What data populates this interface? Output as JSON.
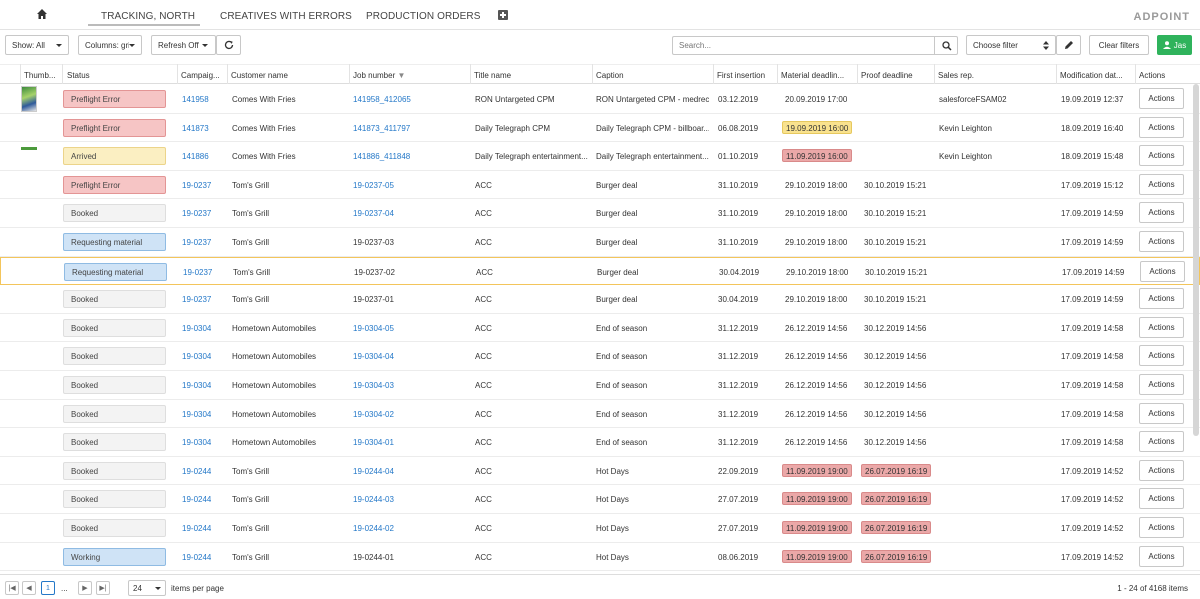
{
  "nav": {
    "tabs": [
      "TRACKING, NORTH",
      "CREATIVES WITH ERRORS",
      "PRODUCTION ORDERS"
    ],
    "brand": "ADPOINT"
  },
  "toolbar": {
    "show": "Show: All",
    "columns": "Columns: grid",
    "refresh": "Refresh Off",
    "search_placeholder": "Search...",
    "choose_filter": "Choose filter",
    "clear_filters": "Clear filters",
    "user": "Jas"
  },
  "columns": [
    "Thumb...",
    "Status",
    "Campaig...",
    "Customer name",
    "Job number",
    "Title name",
    "Caption",
    "First insertion",
    "Material deadlin...",
    "Proof deadline",
    "Sales rep.",
    "Modification dat...",
    "Actions"
  ],
  "action_label": "Actions",
  "rows": [
    {
      "status": "Preflight Error",
      "status_type": "error",
      "campaign": "141958",
      "customer": "Comes With Fries",
      "job": "141958_412065",
      "job_link": true,
      "title": "RON Untargeted CPM",
      "caption": "RON Untargeted CPM - medrec",
      "first": "03.12.2019",
      "material": "20.09.2019 17:00",
      "material_hl": "",
      "proof": "",
      "proof_hl": "",
      "sales": "salesforceFSAM02",
      "modified": "19.09.2019 12:37",
      "thumb": "tall"
    },
    {
      "status": "Preflight Error",
      "status_type": "error",
      "campaign": "141873",
      "customer": "Comes With Fries",
      "job": "141873_411797",
      "job_link": true,
      "title": "Daily Telegraph CPM",
      "caption": "Daily Telegraph CPM - billboar...",
      "first": "06.08.2019",
      "material": "19.09.2019 16:00",
      "material_hl": "yellow",
      "proof": "",
      "proof_hl": "",
      "sales": "Kevin Leighton",
      "modified": "18.09.2019 16:40",
      "thumb": ""
    },
    {
      "status": "Arrived",
      "status_type": "arrived",
      "campaign": "141886",
      "customer": "Comes With Fries",
      "job": "141886_411848",
      "job_link": true,
      "title": "Daily Telegraph entertainment...",
      "caption": "Daily Telegraph entertainment...",
      "first": "01.10.2019",
      "material": "11.09.2019 16:00",
      "material_hl": "red",
      "proof": "",
      "proof_hl": "",
      "sales": "Kevin Leighton",
      "modified": "18.09.2019 15:48",
      "thumb": "wide"
    },
    {
      "status": "Preflight Error",
      "status_type": "error",
      "campaign": "19-0237",
      "customer": "Tom's Grill",
      "job": "19-0237-05",
      "job_link": true,
      "title": "ACC",
      "caption": "Burger deal",
      "first": "31.10.2019",
      "material": "29.10.2019 18:00",
      "material_hl": "",
      "proof": "30.10.2019 15:21",
      "proof_hl": "",
      "sales": "",
      "modified": "17.09.2019 15:12",
      "thumb": ""
    },
    {
      "status": "Booked",
      "status_type": "booked",
      "campaign": "19-0237",
      "customer": "Tom's Grill",
      "job": "19-0237-04",
      "job_link": true,
      "title": "ACC",
      "caption": "Burger deal",
      "first": "31.10.2019",
      "material": "29.10.2019 18:00",
      "material_hl": "",
      "proof": "30.10.2019 15:21",
      "proof_hl": "",
      "sales": "",
      "modified": "17.09.2019 14:59",
      "thumb": ""
    },
    {
      "status": "Requesting material",
      "status_type": "request",
      "campaign": "19-0237",
      "customer": "Tom's Grill",
      "job": "19-0237-03",
      "job_link": false,
      "title": "ACC",
      "caption": "Burger deal",
      "first": "31.10.2019",
      "material": "29.10.2019 18:00",
      "material_hl": "",
      "proof": "30.10.2019 15:21",
      "proof_hl": "",
      "sales": "",
      "modified": "17.09.2019 14:59",
      "thumb": ""
    },
    {
      "status": "Requesting material",
      "status_type": "request",
      "campaign": "19-0237",
      "customer": "Tom's Grill",
      "job": "19-0237-02",
      "job_link": false,
      "title": "ACC",
      "caption": "Burger deal",
      "first": "30.04.2019",
      "material": "29.10.2019 18:00",
      "material_hl": "",
      "proof": "30.10.2019 15:21",
      "proof_hl": "",
      "sales": "",
      "modified": "17.09.2019 14:59",
      "thumb": "",
      "selected": true
    },
    {
      "status": "Booked",
      "status_type": "booked",
      "campaign": "19-0237",
      "customer": "Tom's Grill",
      "job": "19-0237-01",
      "job_link": false,
      "title": "ACC",
      "caption": "Burger deal",
      "first": "30.04.2019",
      "material": "29.10.2019 18:00",
      "material_hl": "",
      "proof": "30.10.2019 15:21",
      "proof_hl": "",
      "sales": "",
      "modified": "17.09.2019 14:59",
      "thumb": ""
    },
    {
      "status": "Booked",
      "status_type": "booked",
      "campaign": "19-0304",
      "customer": "Hometown Automobiles",
      "job": "19-0304-05",
      "job_link": true,
      "title": "ACC",
      "caption": "End of season",
      "first": "31.12.2019",
      "material": "26.12.2019 14:56",
      "material_hl": "",
      "proof": "30.12.2019 14:56",
      "proof_hl": "",
      "sales": "",
      "modified": "17.09.2019 14:58",
      "thumb": ""
    },
    {
      "status": "Booked",
      "status_type": "booked",
      "campaign": "19-0304",
      "customer": "Hometown Automobiles",
      "job": "19-0304-04",
      "job_link": true,
      "title": "ACC",
      "caption": "End of season",
      "first": "31.12.2019",
      "material": "26.12.2019 14:56",
      "material_hl": "",
      "proof": "30.12.2019 14:56",
      "proof_hl": "",
      "sales": "",
      "modified": "17.09.2019 14:58",
      "thumb": ""
    },
    {
      "status": "Booked",
      "status_type": "booked",
      "campaign": "19-0304",
      "customer": "Hometown Automobiles",
      "job": "19-0304-03",
      "job_link": true,
      "title": "ACC",
      "caption": "End of season",
      "first": "31.12.2019",
      "material": "26.12.2019 14:56",
      "material_hl": "",
      "proof": "30.12.2019 14:56",
      "proof_hl": "",
      "sales": "",
      "modified": "17.09.2019 14:58",
      "thumb": ""
    },
    {
      "status": "Booked",
      "status_type": "booked",
      "campaign": "19-0304",
      "customer": "Hometown Automobiles",
      "job": "19-0304-02",
      "job_link": true,
      "title": "ACC",
      "caption": "End of season",
      "first": "31.12.2019",
      "material": "26.12.2019 14:56",
      "material_hl": "",
      "proof": "30.12.2019 14:56",
      "proof_hl": "",
      "sales": "",
      "modified": "17.09.2019 14:58",
      "thumb": ""
    },
    {
      "status": "Booked",
      "status_type": "booked",
      "campaign": "19-0304",
      "customer": "Hometown Automobiles",
      "job": "19-0304-01",
      "job_link": true,
      "title": "ACC",
      "caption": "End of season",
      "first": "31.12.2019",
      "material": "26.12.2019 14:56",
      "material_hl": "",
      "proof": "30.12.2019 14:56",
      "proof_hl": "",
      "sales": "",
      "modified": "17.09.2019 14:58",
      "thumb": ""
    },
    {
      "status": "Booked",
      "status_type": "booked",
      "campaign": "19-0244",
      "customer": "Tom's Grill",
      "job": "19-0244-04",
      "job_link": true,
      "title": "ACC",
      "caption": "Hot Days",
      "first": "22.09.2019",
      "material": "11.09.2019 19:00",
      "material_hl": "red",
      "proof": "26.07.2019 16:19",
      "proof_hl": "red",
      "sales": "",
      "modified": "17.09.2019 14:52",
      "thumb": ""
    },
    {
      "status": "Booked",
      "status_type": "booked",
      "campaign": "19-0244",
      "customer": "Tom's Grill",
      "job": "19-0244-03",
      "job_link": true,
      "title": "ACC",
      "caption": "Hot Days",
      "first": "27.07.2019",
      "material": "11.09.2019 19:00",
      "material_hl": "red",
      "proof": "26.07.2019 16:19",
      "proof_hl": "red",
      "sales": "",
      "modified": "17.09.2019 14:52",
      "thumb": ""
    },
    {
      "status": "Booked",
      "status_type": "booked",
      "campaign": "19-0244",
      "customer": "Tom's Grill",
      "job": "19-0244-02",
      "job_link": true,
      "title": "ACC",
      "caption": "Hot Days",
      "first": "27.07.2019",
      "material": "11.09.2019 19:00",
      "material_hl": "red",
      "proof": "26.07.2019 16:19",
      "proof_hl": "red",
      "sales": "",
      "modified": "17.09.2019 14:52",
      "thumb": ""
    },
    {
      "status": "Working",
      "status_type": "working",
      "campaign": "19-0244",
      "customer": "Tom's Grill",
      "job": "19-0244-01",
      "job_link": false,
      "title": "ACC",
      "caption": "Hot Days",
      "first": "08.06.2019",
      "material": "11.09.2019 19:00",
      "material_hl": "red",
      "proof": "26.07.2019 16:19",
      "proof_hl": "red",
      "sales": "",
      "modified": "17.09.2019 14:52",
      "thumb": ""
    }
  ],
  "footer": {
    "current_page": "1",
    "ellipsis": "...",
    "per_page": "24",
    "per_page_label": "items per page",
    "range": "1 - 24 of 4168 items"
  },
  "colors": {
    "link": "#2478c8",
    "error": "#f6c5c5",
    "arrived": "#fbefc2",
    "request": "#cfe3f6",
    "green": "#2fb35c"
  }
}
